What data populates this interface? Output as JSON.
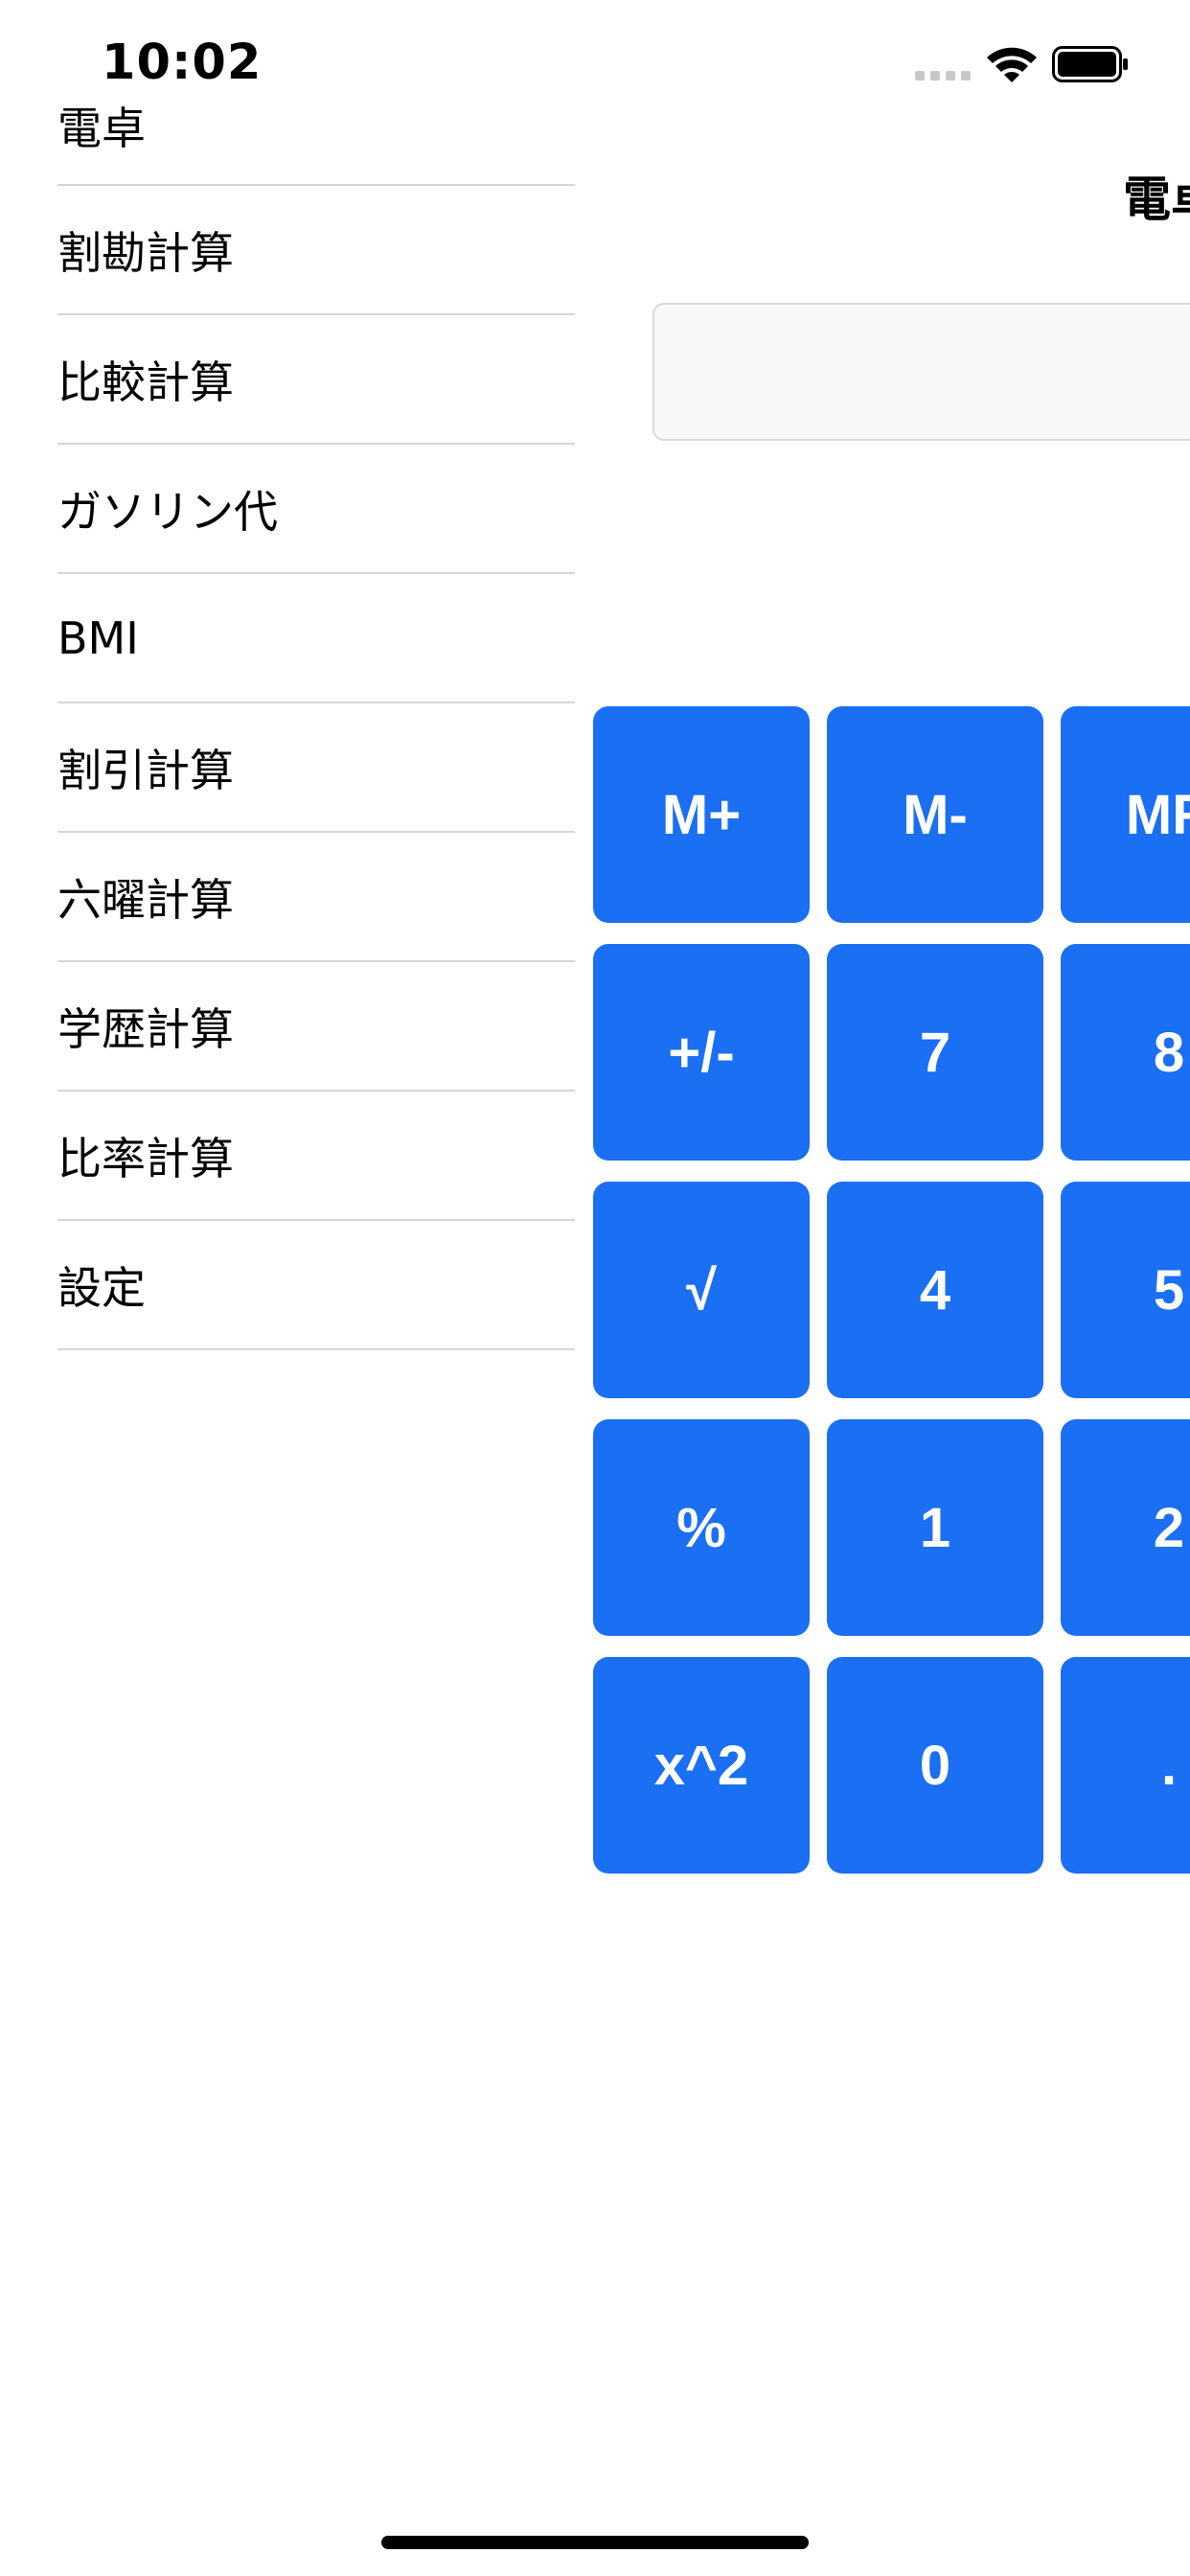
{
  "status_bar": {
    "time": "10:02"
  },
  "menu": {
    "items": [
      {
        "label": "電卓"
      },
      {
        "label": "割勘計算"
      },
      {
        "label": "比較計算"
      },
      {
        "label": "ガソリン代"
      },
      {
        "label": "BMI"
      },
      {
        "label": "割引計算"
      },
      {
        "label": "六曜計算"
      },
      {
        "label": "学歴計算"
      },
      {
        "label": "比率計算"
      },
      {
        "label": "設定"
      }
    ]
  },
  "main": {
    "title": "電卓",
    "display_value": ""
  },
  "keypad": {
    "rows": [
      [
        "M+",
        "M-",
        "MR"
      ],
      [
        "+/-",
        "7",
        "8"
      ],
      [
        "√",
        "4",
        "5"
      ],
      [
        "%",
        "1",
        "2"
      ],
      [
        "x^2",
        "0",
        "."
      ]
    ]
  },
  "colors": {
    "key_background": "#1a6ff2",
    "key_text": "#ffffff",
    "divider": "#d6d6d6"
  }
}
